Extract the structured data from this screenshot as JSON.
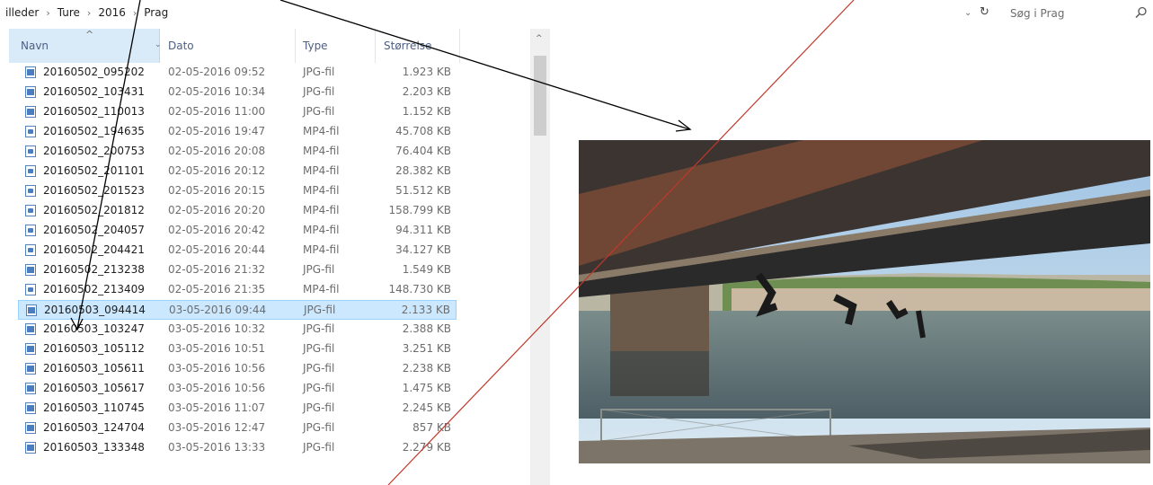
{
  "address_bar": {
    "breadcrumbs": [
      "illeder",
      "Ture",
      "2016",
      "Prag"
    ],
    "separator": "›",
    "dropdown_icon": "chevron-down-icon",
    "refresh_icon": "refresh-icon",
    "refresh_glyph": "↻"
  },
  "search": {
    "placeholder": "Søg i Prag",
    "icon": "search-icon"
  },
  "columns": {
    "name": "Navn",
    "date": "Dato",
    "type": "Type",
    "size": "Størrelse",
    "sort_indicator": "^",
    "chevron": "⌄"
  },
  "files": [
    {
      "name": "20160502_095202",
      "date": "02-05-2016 09:52",
      "type": "JPG-fil",
      "size": "1.923 KB",
      "icon": "image-file-icon"
    },
    {
      "name": "20160502_103431",
      "date": "02-05-2016 10:34",
      "type": "JPG-fil",
      "size": "2.203 KB",
      "icon": "image-file-icon"
    },
    {
      "name": "20160502_110013",
      "date": "02-05-2016 11:00",
      "type": "JPG-fil",
      "size": "1.152 KB",
      "icon": "image-file-icon"
    },
    {
      "name": "20160502_194635",
      "date": "02-05-2016 19:47",
      "type": "MP4-fil",
      "size": "45.708 KB",
      "icon": "video-file-icon"
    },
    {
      "name": "20160502_200753",
      "date": "02-05-2016 20:08",
      "type": "MP4-fil",
      "size": "76.404 KB",
      "icon": "video-file-icon"
    },
    {
      "name": "20160502_201101",
      "date": "02-05-2016 20:12",
      "type": "MP4-fil",
      "size": "28.382 KB",
      "icon": "video-file-icon"
    },
    {
      "name": "20160502_201523",
      "date": "02-05-2016 20:15",
      "type": "MP4-fil",
      "size": "51.512 KB",
      "icon": "video-file-icon"
    },
    {
      "name": "20160502_201812",
      "date": "02-05-2016 20:20",
      "type": "MP4-fil",
      "size": "158.799 KB",
      "icon": "video-file-icon"
    },
    {
      "name": "20160502_204057",
      "date": "02-05-2016 20:42",
      "type": "MP4-fil",
      "size": "94.311 KB",
      "icon": "video-file-icon"
    },
    {
      "name": "20160502_204421",
      "date": "02-05-2016 20:44",
      "type": "MP4-fil",
      "size": "34.127 KB",
      "icon": "video-file-icon"
    },
    {
      "name": "20160502_213238",
      "date": "02-05-2016 21:32",
      "type": "JPG-fil",
      "size": "1.549 KB",
      "icon": "image-file-icon"
    },
    {
      "name": "20160502_213409",
      "date": "02-05-2016 21:35",
      "type": "MP4-fil",
      "size": "148.730 KB",
      "icon": "video-file-icon"
    },
    {
      "name": "20160503_094414",
      "date": "03-05-2016 09:44",
      "type": "JPG-fil",
      "size": "2.133 KB",
      "icon": "image-file-icon",
      "selected": true
    },
    {
      "name": "20160503_103247",
      "date": "03-05-2016 10:32",
      "type": "JPG-fil",
      "size": "2.388 KB",
      "icon": "image-file-icon"
    },
    {
      "name": "20160503_105112",
      "date": "03-05-2016 10:51",
      "type": "JPG-fil",
      "size": "3.251 KB",
      "icon": "image-file-icon"
    },
    {
      "name": "20160503_105611",
      "date": "03-05-2016 10:56",
      "type": "JPG-fil",
      "size": "2.238 KB",
      "icon": "image-file-icon"
    },
    {
      "name": "20160503_105617",
      "date": "03-05-2016 10:56",
      "type": "JPG-fil",
      "size": "1.475 KB",
      "icon": "image-file-icon"
    },
    {
      "name": "20160503_110745",
      "date": "03-05-2016 11:07",
      "type": "JPG-fil",
      "size": "2.245 KB",
      "icon": "image-file-icon"
    },
    {
      "name": "20160503_124704",
      "date": "03-05-2016 12:47",
      "type": "JPG-fil",
      "size": "857 KB",
      "icon": "image-file-icon"
    },
    {
      "name": "20160503_133348",
      "date": "03-05-2016 13:33",
      "type": "JPG-fil",
      "size": "2.279 KB",
      "icon": "image-file-icon"
    }
  ],
  "colors": {
    "selection": "#cce8ff",
    "selection_border": "#99d1ff",
    "header_sorted": "#d9ebf9",
    "header_text": "#4d6082",
    "annotation_black": "#000000",
    "annotation_red": "#c0392b"
  }
}
